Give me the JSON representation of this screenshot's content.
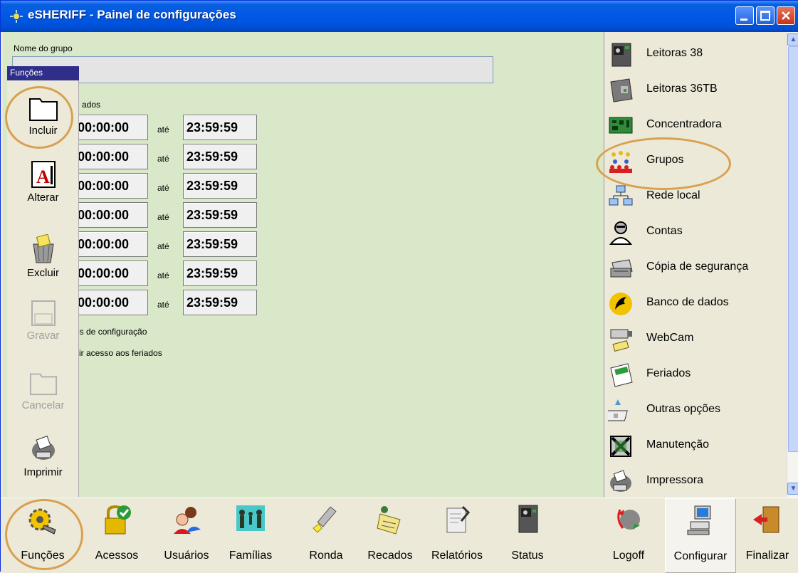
{
  "window": {
    "title": "eSHERIFF - Painel de configurações"
  },
  "form": {
    "group_name_label": "Nome do grupo",
    "group_name_value": "",
    "times_label": "ri ados",
    "ate": "até",
    "rows": [
      {
        "start": "00:00:00",
        "end": "23:59:59"
      },
      {
        "start": "00:00:00",
        "end": "23:59:59"
      },
      {
        "start": "00:00:00",
        "end": "23:59:59"
      },
      {
        "start": "00:00:00",
        "end": "23:59:59"
      },
      {
        "start": "00:00:00",
        "end": "23:59:59"
      },
      {
        "start": "00:00:00",
        "end": "23:59:59"
      },
      {
        "start": "00:00:00",
        "end": "23:59:59"
      }
    ],
    "config_label": "es de configuração",
    "holiday_label": "itir acesso aos feriados"
  },
  "funcoes": {
    "header": "Funções",
    "items": [
      {
        "label": "Incluir",
        "enabled": true,
        "icon": "folder-icon"
      },
      {
        "label": "Alterar",
        "enabled": true,
        "icon": "edit-document-icon"
      },
      {
        "label": "Excluir",
        "enabled": true,
        "icon": "trash-icon"
      },
      {
        "label": "Gravar",
        "enabled": false,
        "icon": "save-icon"
      },
      {
        "label": "Cancelar",
        "enabled": false,
        "icon": "folder-icon"
      },
      {
        "label": "Imprimir",
        "enabled": true,
        "icon": "printer-icon"
      }
    ]
  },
  "nav": {
    "items": [
      {
        "label": "Leitoras 38",
        "icon": "reader-icon"
      },
      {
        "label": "Leitoras 36TB",
        "icon": "reader-tb-icon"
      },
      {
        "label": "Concentradora",
        "icon": "circuit-board-icon"
      },
      {
        "label": "Grupos",
        "icon": "groups-icon"
      },
      {
        "label": "Rede local",
        "icon": "network-icon"
      },
      {
        "label": "Contas",
        "icon": "accounts-icon"
      },
      {
        "label": "Cópia de segurança",
        "icon": "backup-icon"
      },
      {
        "label": "Banco de dados",
        "icon": "database-icon"
      },
      {
        "label": "WebCam",
        "icon": "webcam-icon"
      },
      {
        "label": "Feriados",
        "icon": "calendar-icon"
      },
      {
        "label": "Outras opções",
        "icon": "options-icon"
      },
      {
        "label": "Manutenção",
        "icon": "maintenance-icon"
      },
      {
        "label": "Impressora",
        "icon": "printer-icon"
      }
    ]
  },
  "bottom": {
    "items": [
      {
        "label": "Funções",
        "icon": "gear-wrench-icon"
      },
      {
        "label": "Acessos",
        "icon": "lock-check-icon"
      },
      {
        "label": "Usuários",
        "icon": "users-icon"
      },
      {
        "label": "Famílias",
        "icon": "family-icon"
      },
      {
        "label": "Ronda",
        "icon": "flashlight-icon"
      },
      {
        "label": "Recados",
        "icon": "note-icon"
      },
      {
        "label": "Relatórios",
        "icon": "report-icon"
      },
      {
        "label": "Status",
        "icon": "status-device-icon"
      },
      {
        "label": "Logoff",
        "icon": "logoff-icon"
      },
      {
        "label": "Configurar",
        "icon": "configure-computer-icon",
        "active": true
      },
      {
        "label": "Finalizar",
        "icon": "exit-door-icon"
      }
    ]
  },
  "colors": {
    "form_bg": "#d8e8c8",
    "accent_circle": "#d9a050",
    "titlebar": "#0058e6"
  }
}
